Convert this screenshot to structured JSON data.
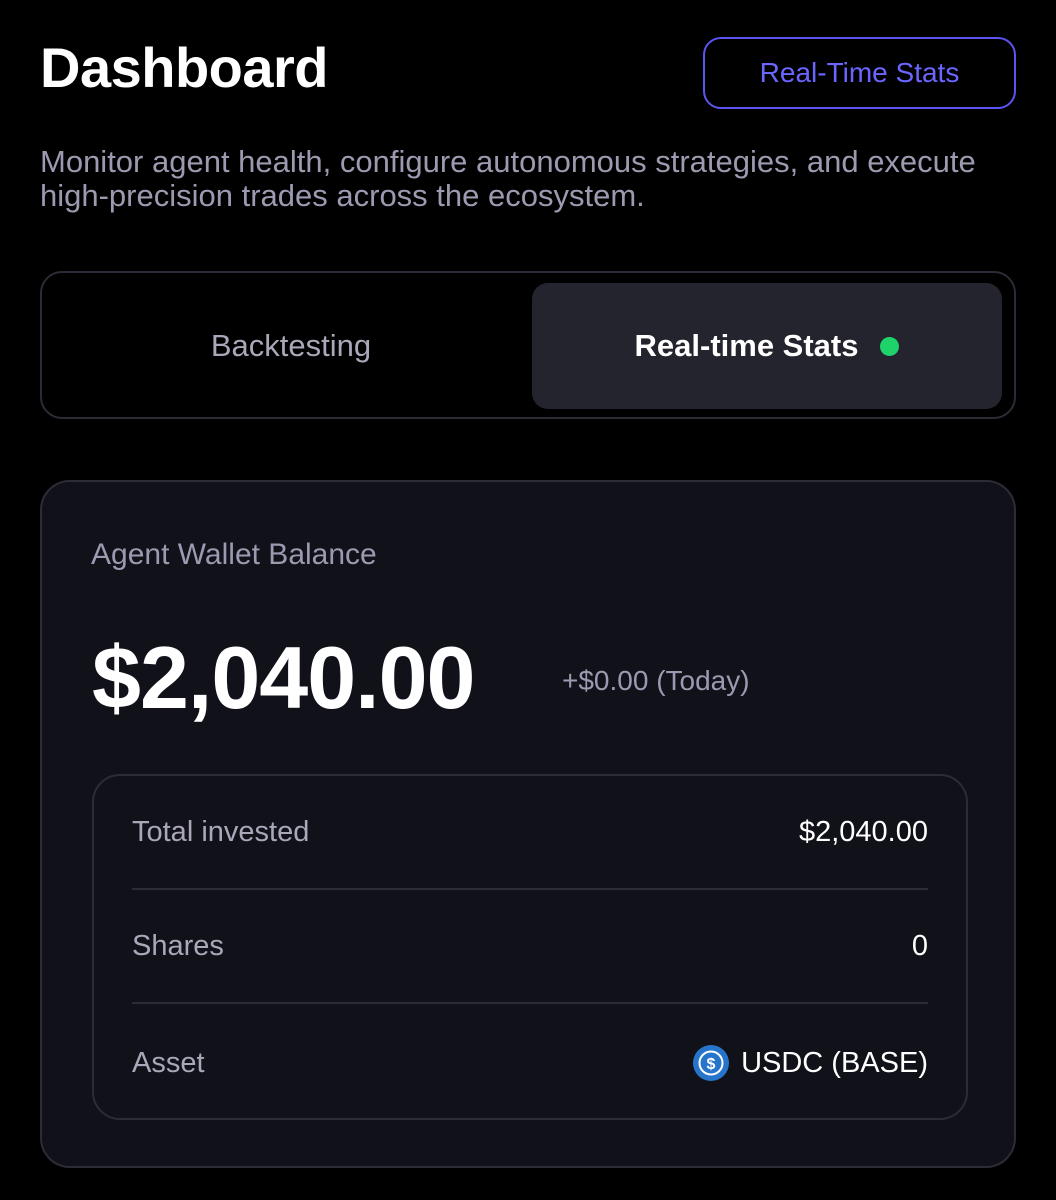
{
  "header": {
    "title": "Dashboard",
    "action_button_label": "Real-Time Stats",
    "subtitle": "Monitor agent health, configure autonomous strategies, and execute high-precision trades across the ecosystem."
  },
  "tabs": [
    {
      "label": "Backtesting",
      "active": false
    },
    {
      "label": "Real-time Stats",
      "active": true,
      "status_indicator": "live",
      "status_color": "#1fd36b"
    }
  ],
  "wallet": {
    "label": "Agent Wallet Balance",
    "balance": "$2,040.00",
    "change": "+$0.00 (Today)",
    "details": [
      {
        "label": "Total invested",
        "value": "$2,040.00"
      },
      {
        "label": "Shares",
        "value": "0"
      },
      {
        "label": "Asset",
        "value": "USDC (BASE)",
        "icon": "usdc-icon"
      }
    ]
  },
  "colors": {
    "accent": "#5a55f0",
    "live": "#1fd36b",
    "usdc": "#2775ca"
  }
}
